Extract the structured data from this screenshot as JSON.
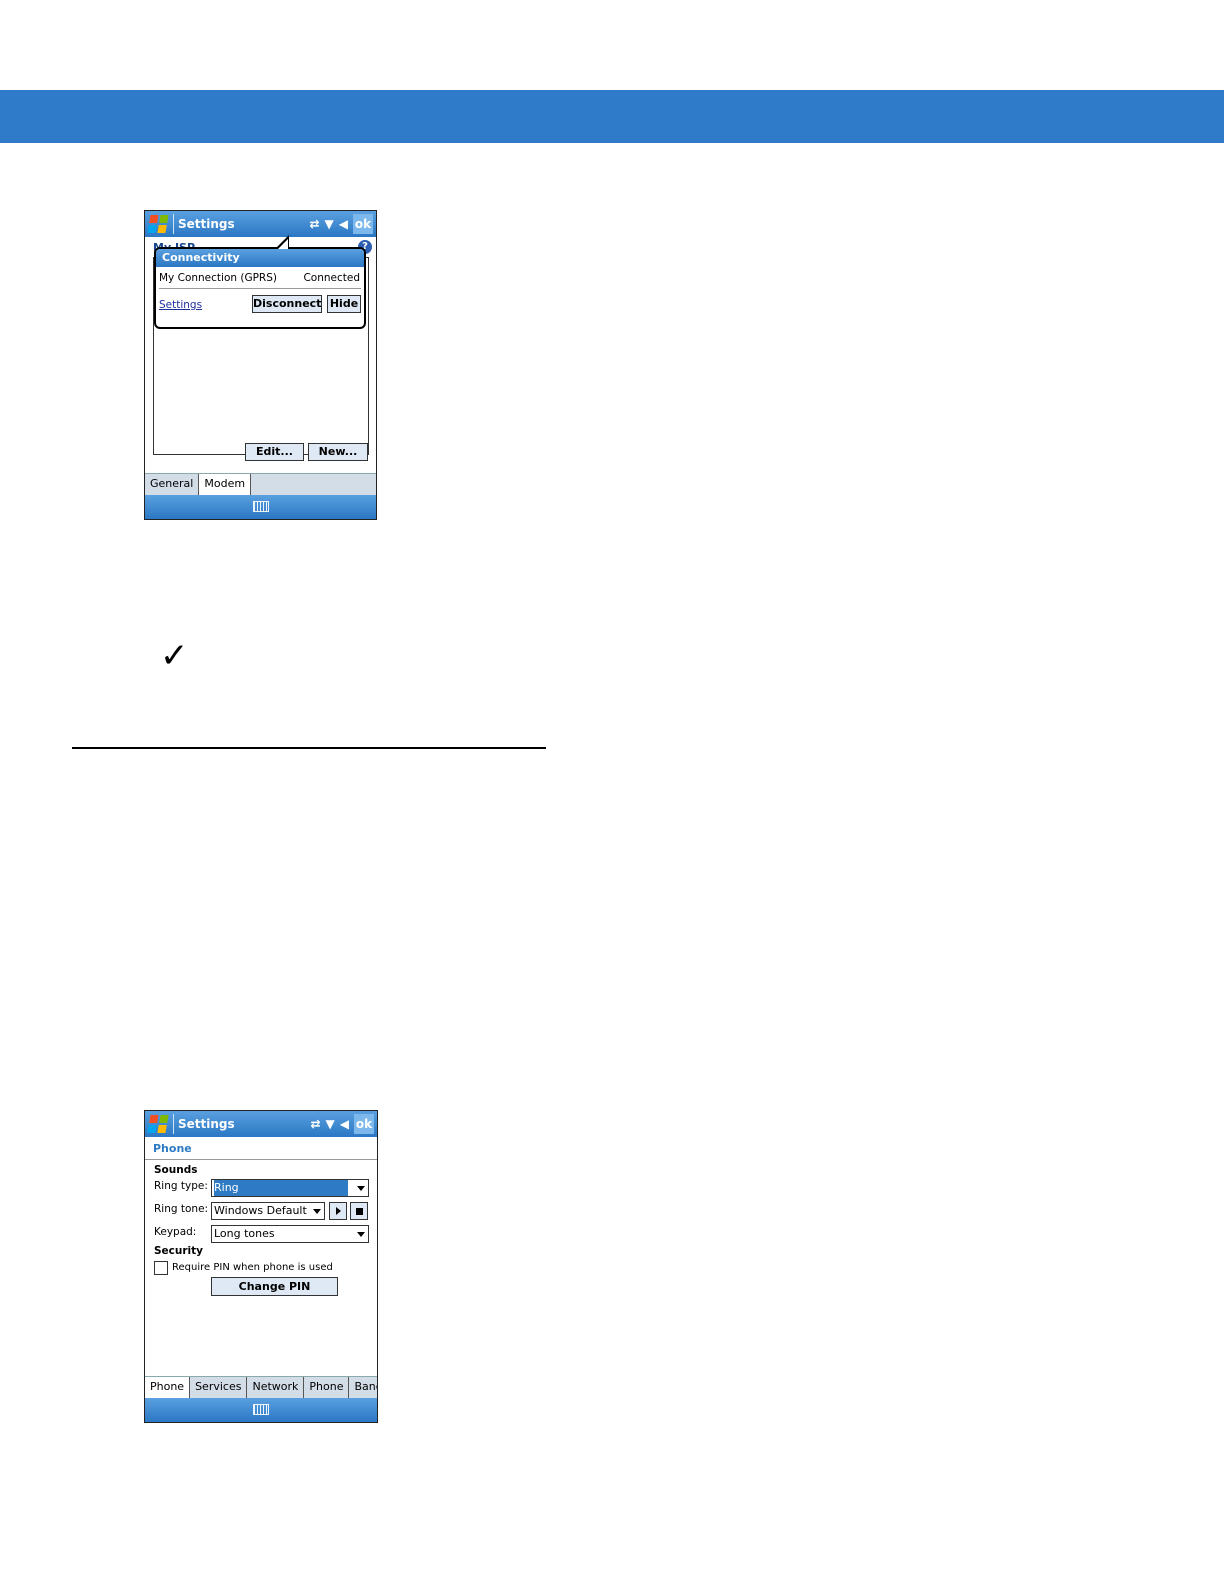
{
  "colors": {
    "banner": "#2f7bc9",
    "titlebar": "#2b77c4",
    "accent_text": "#2e7bc4"
  },
  "screen1": {
    "title": "Settings",
    "ok_label": "ok",
    "page_heading": "My ISP",
    "popup": {
      "title": "Connectivity",
      "connection_name": "My Connection (GPRS)",
      "connection_status": "Connected",
      "settings_link": "Settings",
      "disconnect_label": "Disconnect",
      "hide_label": "Hide"
    },
    "edit_label": "Edit...",
    "new_label": "New...",
    "tabs": [
      "General",
      "Modem"
    ]
  },
  "screen2": {
    "title": "Settings",
    "ok_label": "ok",
    "page_heading": "Phone",
    "sounds_heading": "Sounds",
    "ring_type_label": "Ring type:",
    "ring_type_value": "Ring",
    "ring_tone_label": "Ring tone:",
    "ring_tone_value": "Windows Default",
    "keypad_label": "Keypad:",
    "keypad_value": "Long tones",
    "security_heading": "Security",
    "require_pin_label": "Require PIN when phone is used",
    "change_pin_label": "Change PIN",
    "tabs": [
      "Phone",
      "Services",
      "Network",
      "Phone Info",
      "Band"
    ]
  }
}
